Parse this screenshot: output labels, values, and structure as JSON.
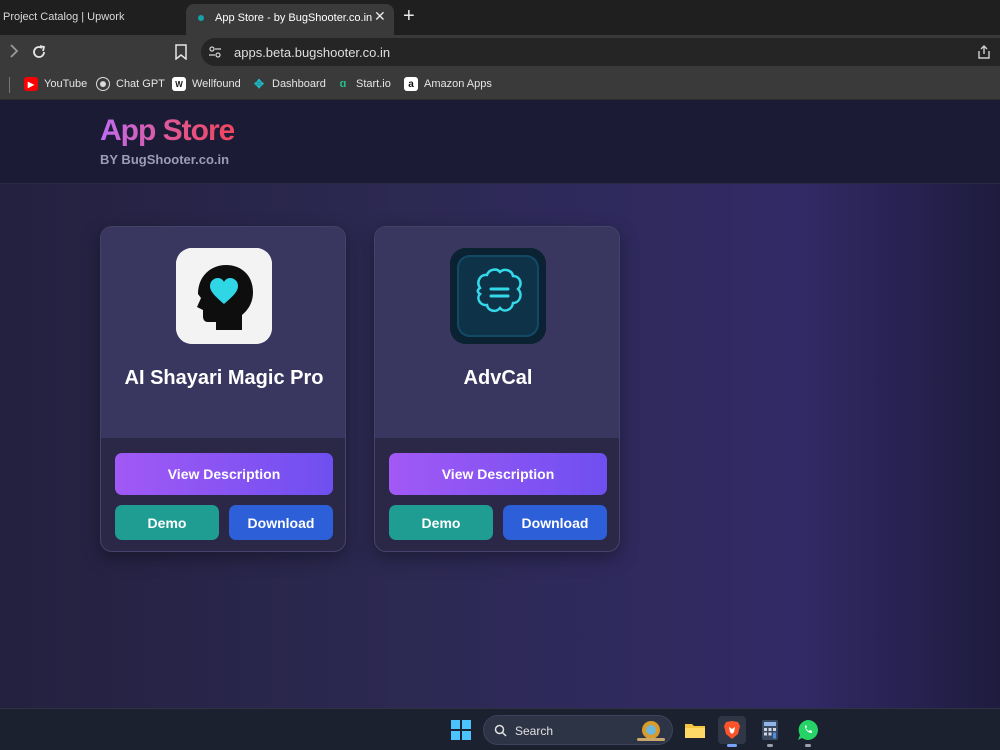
{
  "browser": {
    "tabs": [
      {
        "title": "Project Catalog | Upwork",
        "active": false
      },
      {
        "title": "App Store - by BugShooter.co.in",
        "active": true
      }
    ],
    "close_glyph": "✕",
    "new_tab_glyph": "+",
    "url": "apps.beta.bugshooter.co.in",
    "bookmarks": [
      {
        "label": "YouTube",
        "icon": "youtube-icon",
        "color": "#ff0000"
      },
      {
        "label": "Chat GPT",
        "icon": "chatgpt-icon",
        "color": "#ffffff"
      },
      {
        "label": "Wellfound",
        "icon": "wellfound-icon",
        "color": "#ffffff"
      },
      {
        "label": "Dashboard",
        "icon": "dashboard-icon",
        "color": "#1fb6c4"
      },
      {
        "label": "Start.io",
        "icon": "startio-icon",
        "color": "#22c38e"
      },
      {
        "label": "Amazon Apps",
        "icon": "amazon-icon",
        "color": "#ffffff"
      }
    ]
  },
  "header": {
    "title": "App Store",
    "subtitle": "BY BugShooter.co.in"
  },
  "apps": [
    {
      "name": "AI Shayari Magic Pro",
      "icon": "head-heart-icon",
      "view_label": "View Description",
      "demo_label": "Demo",
      "download_label": "Download"
    },
    {
      "name": "AdvCal",
      "icon": "brain-icon",
      "view_label": "View Description",
      "demo_label": "Demo",
      "download_label": "Download"
    }
  ],
  "taskbar": {
    "search_label": "Search",
    "items": [
      "windows-start-icon",
      "search-icon",
      "file-explorer-icon",
      "brave-icon",
      "calculator-icon",
      "whatsapp-icon"
    ]
  },
  "colors": {
    "accent_purple": "#a259f5",
    "demo_teal": "#1f9d93",
    "download_blue": "#2d5fd9",
    "title_gradient_start": "#c06cf2",
    "title_gradient_end": "#f0465e"
  }
}
